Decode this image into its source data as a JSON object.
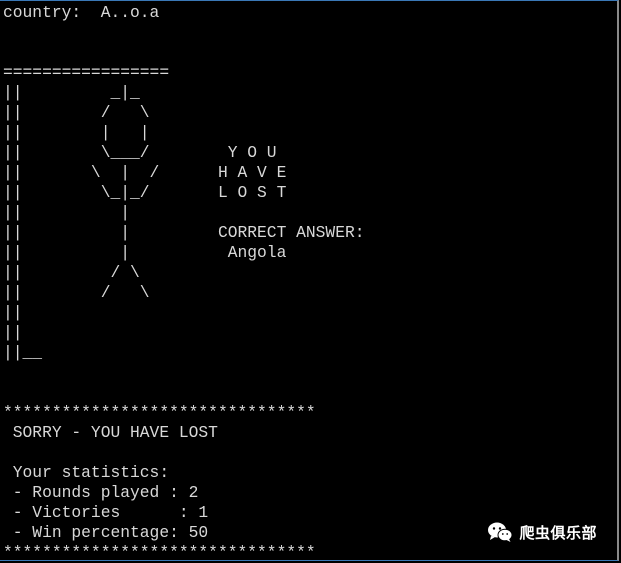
{
  "terminal": {
    "lines": [
      "country:  A..o.a",
      "",
      "",
      "=================",
      "||         _|_",
      "||        /   \\",
      "||        |   |",
      "||        \\___/        Y O U",
      "||       \\  |  /      H A V E",
      "||        \\_|_/       L O S T",
      "||          |",
      "||          |         CORRECT ANSWER:",
      "||          |          Angola",
      "||         / \\",
      "||        /   \\",
      "||",
      "||",
      "||__",
      "",
      "",
      "********************************",
      " SORRY - YOU HAVE LOST",
      "",
      " Your statistics:",
      " - Rounds played : 2",
      " - Victories      : 1",
      " - Win percentage: 50",
      "********************************"
    ]
  },
  "watermark": {
    "logo_icon": "wechat-logo-icon",
    "text": "爬虫俱乐部"
  }
}
